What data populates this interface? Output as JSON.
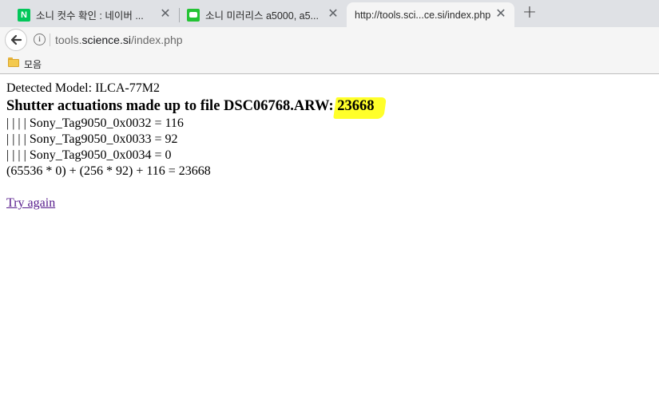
{
  "browser": {
    "tabs": [
      {
        "title": "소니 컷수 확인 : 네이버 ...",
        "favicon": "naver-icon",
        "favicon_text": "N"
      },
      {
        "title": "소니 미러리스 a5000, a5...",
        "favicon": "blog-icon"
      },
      {
        "title": "http://tools.sci...ce.si/index.php",
        "favicon": "none"
      }
    ],
    "close_glyph": "✕",
    "new_tab_glyph": "+",
    "address": {
      "prefix": "tools.",
      "domain": "science.si",
      "path": "/index.php",
      "info_glyph": "i"
    },
    "bookmarks": [
      {
        "label": "모음",
        "icon": "folder-icon"
      }
    ]
  },
  "page": {
    "detected_model": "Detected Model: ILCA-77M2",
    "heading_prefix": "Shutter actuations made up to file DSC06768.ARW: ",
    "heading_count": "23668",
    "tags": [
      "| | | | Sony_Tag9050_0x0032 = 116",
      "| | | | Sony_Tag9050_0x0033 = 92",
      "| | | | Sony_Tag9050_0x0034 = 0"
    ],
    "formula": "(65536 * 0) + (256 * 92) + 116 = 23668",
    "try_again": "Try again"
  },
  "colors": {
    "highlight": "#ffff2a",
    "link_visited": "#551a8b",
    "tabstrip": "#dfe1e5",
    "toolbar": "#f5f5f5"
  }
}
